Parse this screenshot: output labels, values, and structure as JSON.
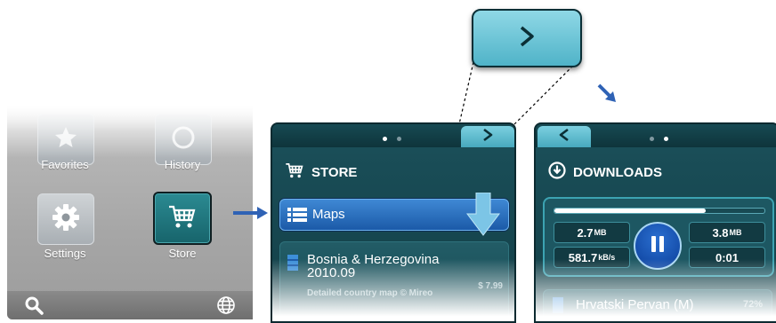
{
  "menu": {
    "tiles": [
      {
        "label": "Favorites",
        "icon": "star-icon"
      },
      {
        "label": "History",
        "icon": "clock-icon"
      },
      {
        "label": "Settings",
        "icon": "gear-icon"
      },
      {
        "label": "Store",
        "icon": "cart-icon",
        "selected": true
      }
    ],
    "bottom_bar": {
      "left_icon": "search-icon",
      "right_icon": "globe-icon"
    }
  },
  "store": {
    "title": "STORE",
    "page_dots": {
      "count": 2,
      "active": 1
    },
    "nav_button_icon": "chevron-right-icon",
    "maps_row": {
      "label": "Maps",
      "icon": "list-icon"
    },
    "country": {
      "name": "Bosnia & Herzegovina 2010.09",
      "description": "Detailed country map © Mireo",
      "price": "$ 7.99"
    }
  },
  "downloads": {
    "title": "DOWNLOADS",
    "page_dots": {
      "count": 2,
      "active": 2
    },
    "nav_button_icon": "chevron-left-icon",
    "progress_fraction": 0.72,
    "downloaded": {
      "value": "2.7",
      "unit": "MB"
    },
    "total": {
      "value": "3.8",
      "unit": "MB"
    },
    "speed": {
      "value": "581.7",
      "unit": "kB/s"
    },
    "time_left": "0:01",
    "queue_item": {
      "label": "Hrvatski Pervan (M)",
      "percent": "72%"
    }
  },
  "callout": {
    "icon": "chevron-right-icon"
  },
  "colors": {
    "accent_teal": "#123c44",
    "tab_cyan": "#6ccbe0",
    "maps_blue": "#2a6fbf",
    "arrow_blue": "#2f62b5",
    "download_arrow": "#7cc5e6"
  }
}
